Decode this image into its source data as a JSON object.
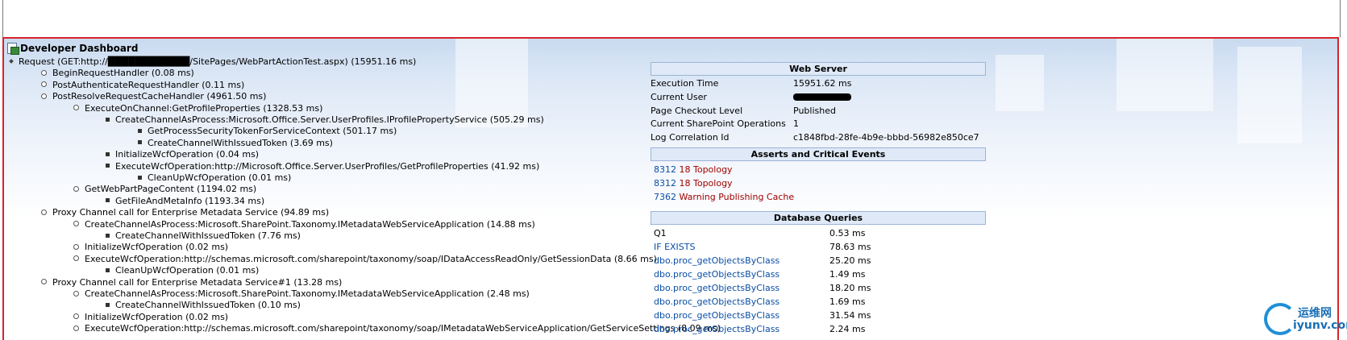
{
  "title": "Developer Dashboard",
  "tree": [
    {
      "level": 0,
      "text": "Request (GET:http://████████████/SitePages/WebPartActionTest.aspx) (15951.16 ms)"
    },
    {
      "level": 1,
      "text": "BeginRequestHandler (0.08 ms)"
    },
    {
      "level": 1,
      "text": "PostAuthenticateRequestHandler (0.11 ms)"
    },
    {
      "level": 1,
      "text": "PostResolveRequestCacheHandler (4961.50 ms)"
    },
    {
      "level": 2,
      "text": "ExecuteOnChannel:GetProfileProperties (1328.53 ms)"
    },
    {
      "level": 3,
      "text": "CreateChannelAsProcess:Microsoft.Office.Server.UserProfiles.IProfilePropertyService (505.29 ms)"
    },
    {
      "level": 4,
      "text": "GetProcessSecurityTokenForServiceContext (501.17 ms)"
    },
    {
      "level": 4,
      "text": "CreateChannelWithIssuedToken (3.69 ms)"
    },
    {
      "level": 3,
      "text": "InitializeWcfOperation (0.04 ms)"
    },
    {
      "level": 3,
      "text": "ExecuteWcfOperation:http://Microsoft.Office.Server.UserProfiles/GetProfileProperties (41.92 ms)"
    },
    {
      "level": 4,
      "text": "CleanUpWcfOperation (0.01 ms)"
    },
    {
      "level": 2,
      "text": "GetWebPartPageContent (1194.02 ms)"
    },
    {
      "level": 3,
      "text": "GetFileAndMetaInfo (1193.34 ms)"
    },
    {
      "level": 1,
      "text": "Proxy Channel call for Enterprise Metadata Service (94.89 ms)"
    },
    {
      "level": 2,
      "text": "CreateChannelAsProcess:Microsoft.SharePoint.Taxonomy.IMetadataWebServiceApplication (14.88 ms)"
    },
    {
      "level": 3,
      "text": "CreateChannelWithIssuedToken (7.76 ms)"
    },
    {
      "level": 2,
      "text": "InitializeWcfOperation (0.02 ms)"
    },
    {
      "level": 2,
      "text": "ExecuteWcfOperation:http://schemas.microsoft.com/sharepoint/taxonomy/soap/IDataAccessReadOnly/GetSessionData (8.66 ms)"
    },
    {
      "level": 3,
      "text": "CleanUpWcfOperation (0.01 ms)"
    },
    {
      "level": 1,
      "text": "Proxy Channel call for Enterprise Metadata Service#1 (13.28 ms)"
    },
    {
      "level": 2,
      "text": "CreateChannelAsProcess:Microsoft.SharePoint.Taxonomy.IMetadataWebServiceApplication (2.48 ms)"
    },
    {
      "level": 3,
      "text": "CreateChannelWithIssuedToken (0.10 ms)"
    },
    {
      "level": 2,
      "text": "InitializeWcfOperation (0.02 ms)"
    },
    {
      "level": 2,
      "text": "ExecuteWcfOperation:http://schemas.microsoft.com/sharepoint/taxonomy/soap/IMetadataWebServiceApplication/GetServiceSettings (8.09 ms)"
    }
  ],
  "web_server": {
    "title": "Web Server",
    "rows": [
      {
        "label": "Execution Time",
        "value": "15951.62 ms"
      },
      {
        "label": "Current User",
        "value": ""
      },
      {
        "label": "Page Checkout Level",
        "value": "Published"
      },
      {
        "label": "Current SharePoint Operations",
        "value": "1"
      },
      {
        "label": "Log Correlation Id",
        "value": "c1848fbd-28fe-4b9e-bbbd-56982e850ce7"
      }
    ]
  },
  "asserts": {
    "title": "Asserts and Critical Events",
    "rows": [
      {
        "id": "8312",
        "text": "18 Topology"
      },
      {
        "id": "8312",
        "text": "18 Topology"
      },
      {
        "id": "7362",
        "text": "Warning Publishing Cache"
      }
    ]
  },
  "db": {
    "title": "Database Queries",
    "rows": [
      {
        "name": "Q1",
        "time": "0.53 ms",
        "link": false
      },
      {
        "name": "IF EXISTS",
        "time": "78.63 ms",
        "link": true
      },
      {
        "name": "dbo.proc_getObjectsByClass",
        "time": "25.20 ms",
        "link": true
      },
      {
        "name": "dbo.proc_getObjectsByClass",
        "time": "1.49 ms",
        "link": true
      },
      {
        "name": "dbo.proc_getObjectsByClass",
        "time": "18.20 ms",
        "link": true
      },
      {
        "name": "dbo.proc_getObjectsByClass",
        "time": "1.69 ms",
        "link": true
      },
      {
        "name": "dbo.proc_getObjectsByClass",
        "time": "31.54 ms",
        "link": true
      },
      {
        "name": "dbo.proc_getObjectsByClass",
        "time": "2.24 ms",
        "link": true
      }
    ]
  },
  "watermark": {
    "line1": "运维网",
    "line2": "iyunv.com"
  },
  "colors": {
    "border": "#d8232a",
    "link": "#0a4ea5",
    "critical": "#a00000",
    "header_bg": "#dfe9f7"
  }
}
